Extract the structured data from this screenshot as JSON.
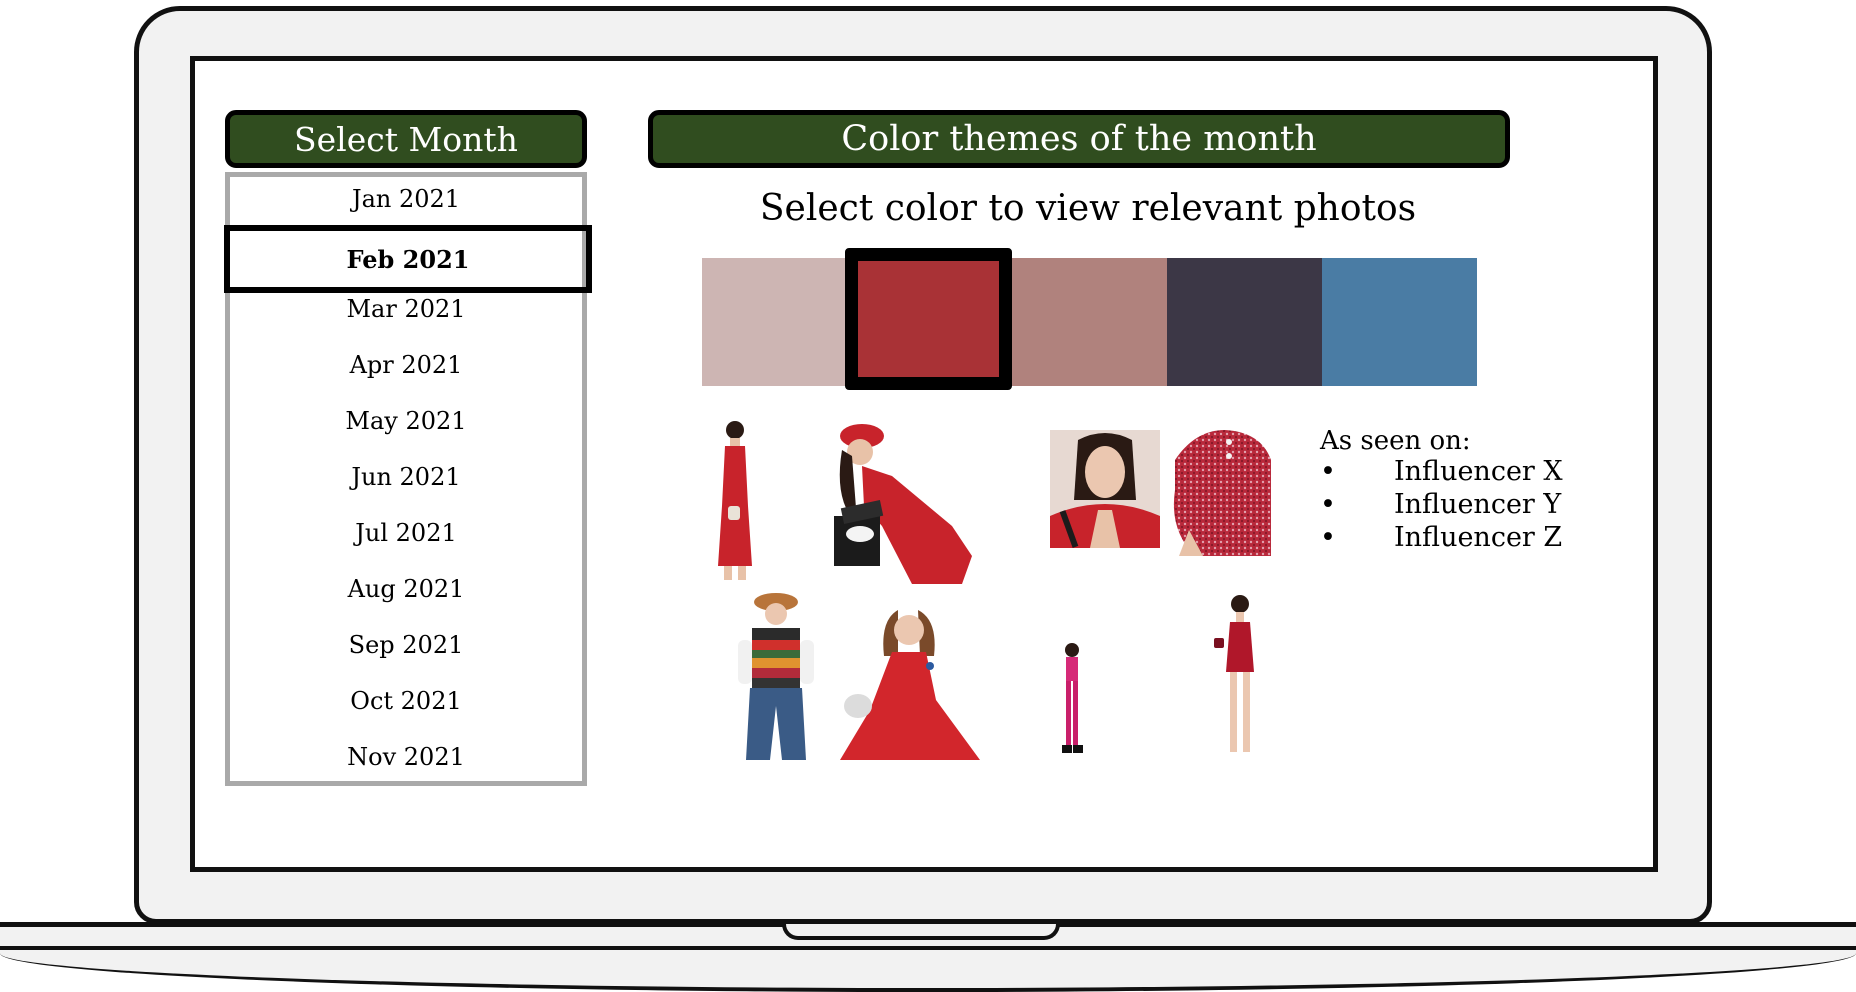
{
  "months_panel": {
    "title": "Select Month",
    "items": [
      "Jan 2021",
      "Feb 2021",
      "Mar 2021",
      "Apr 2021",
      "May 2021",
      "Jun 2021",
      "Jul 2021",
      "Aug 2021",
      "Sep 2021",
      "Oct 2021",
      "Nov 2021"
    ],
    "selected": "Feb 2021"
  },
  "themes_panel": {
    "title": "Color themes of the month",
    "instruction": "Select color to view relevant photos",
    "swatches": [
      {
        "color": "#cdb5b3"
      },
      {
        "color": "#a93236",
        "selected": true
      },
      {
        "color": "#b0827d"
      },
      {
        "color": "#3c3746"
      },
      {
        "color": "#4a7ca4"
      }
    ],
    "photos": [
      {
        "name": "photo-red-maxi-dress"
      },
      {
        "name": "photo-red-dress-with-box"
      },
      {
        "name": "photo-red-jacket-portrait"
      },
      {
        "name": "photo-red-tweed-top"
      },
      {
        "name": "photo-striped-knit-jeans"
      },
      {
        "name": "photo-red-flowy-dress"
      },
      {
        "name": "photo-pink-sportswear"
      },
      {
        "name": "photo-red-mini-dress"
      }
    ]
  },
  "influencers": {
    "heading": "As seen on:",
    "bullet": "•",
    "items": [
      "Influencer X",
      "Influencer Y",
      "Influencer Z"
    ]
  }
}
